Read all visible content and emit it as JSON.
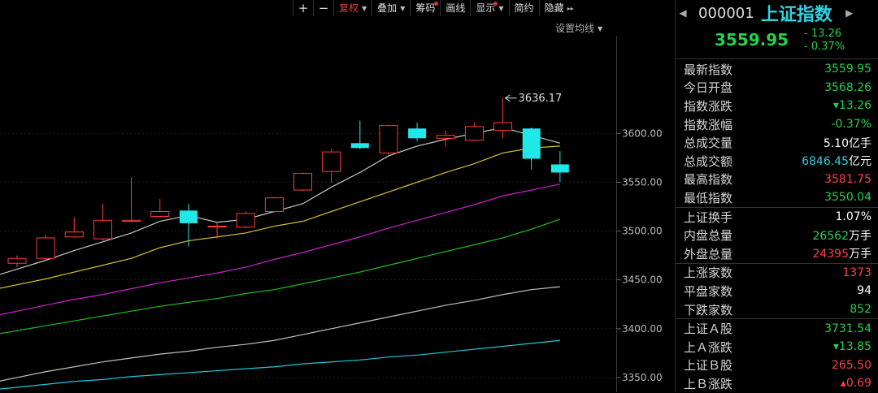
{
  "toolbar": {
    "zoom_in": "+",
    "zoom_out": "−",
    "adjust": "复权",
    "overlay": "叠加",
    "chips": "筹码",
    "draw": "画线",
    "display": "显示",
    "simple": "简约",
    "hide": "隐藏"
  },
  "settings_label": "设置均线",
  "quote": {
    "code": "000001",
    "name": "上证指数",
    "price": "3559.95",
    "change": "- 13.26",
    "change_pct": "- 0.37%",
    "rows": [
      {
        "label": "最新指数",
        "value": "3559.95",
        "color": "dn",
        "unit": ""
      },
      {
        "label": "今日开盘",
        "value": "3568.26",
        "color": "dn",
        "unit": ""
      },
      {
        "label": "指数涨跌",
        "value": "▾13.26",
        "color": "dn",
        "unit": ""
      },
      {
        "label": "指数涨幅",
        "value": "-0.37%",
        "color": "dn",
        "unit": ""
      },
      {
        "label": "总成交量",
        "value": "5.10",
        "color": "wt",
        "unit": "亿手"
      },
      {
        "label": "总成交额",
        "value": "6846.45",
        "color": "cy",
        "unit": "亿元"
      },
      {
        "label": "最高指数",
        "value": "3581.75",
        "color": "up",
        "unit": ""
      },
      {
        "label": "最低指数",
        "value": "3550.04",
        "color": "dn",
        "unit": ""
      },
      {
        "label": "上证换手",
        "value": "1.07%",
        "color": "wt",
        "unit": ""
      },
      {
        "label": "内盘总量",
        "value": "26562",
        "color": "dn",
        "unit": "万手"
      },
      {
        "label": "外盘总量",
        "value": "24395",
        "color": "up",
        "unit": "万手"
      },
      {
        "label": "上涨家数",
        "value": "1373",
        "color": "up",
        "unit": ""
      },
      {
        "label": "平盘家数",
        "value": "94",
        "color": "wt",
        "unit": ""
      },
      {
        "label": "下跌家数",
        "value": "852",
        "color": "dn",
        "unit": ""
      },
      {
        "label": "上证Ａ股",
        "value": "3731.54",
        "color": "dn",
        "unit": ""
      },
      {
        "label": "上Ａ涨跌",
        "value": "▾13.85",
        "color": "dn",
        "unit": ""
      },
      {
        "label": "上证Ｂ股",
        "value": "265.50",
        "color": "up",
        "unit": ""
      },
      {
        "label": "上Ｂ涨跌",
        "value": "▴0.69",
        "color": "up",
        "unit": ""
      }
    ]
  },
  "chart_data": {
    "type": "candlestick",
    "ylim": [
      3335,
      3700
    ],
    "yticks": [
      "3600.00",
      "3550.00",
      "3500.00",
      "3450.00",
      "3400.00",
      "3350.00"
    ],
    "ytick_values": [
      3600,
      3550,
      3500,
      3450,
      3400,
      3350
    ],
    "annotation": "3636.17",
    "candles": [
      {
        "o": 3467,
        "c": 3472,
        "h": 3475,
        "l": 3463
      },
      {
        "o": 3472,
        "c": 3493,
        "h": 3496,
        "l": 3470
      },
      {
        "o": 3494,
        "c": 3499,
        "h": 3514,
        "l": 3493
      },
      {
        "o": 3492,
        "c": 3511,
        "h": 3528,
        "l": 3490
      },
      {
        "o": 3510,
        "c": 3511,
        "h": 3555,
        "l": 3509
      },
      {
        "o": 3515,
        "c": 3520,
        "h": 3533,
        "l": 3514
      },
      {
        "o": 3521,
        "c": 3508,
        "h": 3528,
        "l": 3484
      },
      {
        "o": 3505,
        "c": 3505,
        "h": 3509,
        "l": 3492
      },
      {
        "o": 3504,
        "c": 3518,
        "h": 3520,
        "l": 3503
      },
      {
        "o": 3520,
        "c": 3534,
        "h": 3535,
        "l": 3519
      },
      {
        "o": 3542,
        "c": 3559,
        "h": 3560,
        "l": 3541
      },
      {
        "o": 3561,
        "c": 3581,
        "h": 3584,
        "l": 3549
      },
      {
        "o": 3590,
        "c": 3585,
        "h": 3613,
        "l": 3584
      },
      {
        "o": 3580,
        "c": 3608,
        "h": 3609,
        "l": 3578
      },
      {
        "o": 3605,
        "c": 3595,
        "h": 3611,
        "l": 3592
      },
      {
        "o": 3595,
        "c": 3598,
        "h": 3603,
        "l": 3586
      },
      {
        "o": 3593,
        "c": 3607,
        "h": 3611,
        "l": 3592
      },
      {
        "o": 3603,
        "c": 3611,
        "h": 3636.17,
        "l": 3595
      },
      {
        "o": 3605,
        "c": 3574,
        "h": 3606,
        "l": 3563
      },
      {
        "o": 3568.26,
        "c": 3559.95,
        "h": 3581.75,
        "l": 3550.04
      }
    ],
    "ma": [
      {
        "color": "#c8c8c8",
        "values": [
          3461,
          3470,
          3480,
          3489,
          3498,
          3510,
          3516,
          3509,
          3512,
          3520,
          3528,
          3545,
          3560,
          3577,
          3587,
          3594,
          3600,
          3606,
          3598,
          3590
        ]
      },
      {
        "color": "#d8c228",
        "values": [
          3445,
          3451,
          3458,
          3465,
          3472,
          3483,
          3490,
          3494,
          3498,
          3505,
          3510,
          3520,
          3530,
          3540,
          3550,
          3560,
          3569,
          3580,
          3585,
          3587
        ]
      },
      {
        "color": "#d020d0",
        "values": [
          3418,
          3424,
          3430,
          3435,
          3441,
          3447,
          3452,
          3457,
          3463,
          3471,
          3478,
          3486,
          3494,
          3503,
          3511,
          3519,
          3527,
          3536,
          3542,
          3548
        ]
      },
      {
        "color": "#20c020",
        "values": [
          3398,
          3403,
          3408,
          3413,
          3418,
          3423,
          3427,
          3431,
          3436,
          3440,
          3446,
          3452,
          3458,
          3465,
          3472,
          3479,
          3486,
          3493,
          3502,
          3512
        ]
      },
      {
        "color": "#bfbfbf",
        "values": [
          3350,
          3356,
          3361,
          3366,
          3370,
          3374,
          3377,
          3381,
          3384,
          3388,
          3394,
          3400,
          3406,
          3412,
          3418,
          3424,
          3429,
          3435,
          3440,
          3443
        ]
      },
      {
        "color": "#20c8d8",
        "values": [
          3340,
          3343,
          3346,
          3348,
          3351,
          3353,
          3355,
          3357,
          3359,
          3361,
          3364,
          3366,
          3368,
          3371,
          3373,
          3376,
          3379,
          3382,
          3385,
          3388
        ]
      }
    ]
  }
}
